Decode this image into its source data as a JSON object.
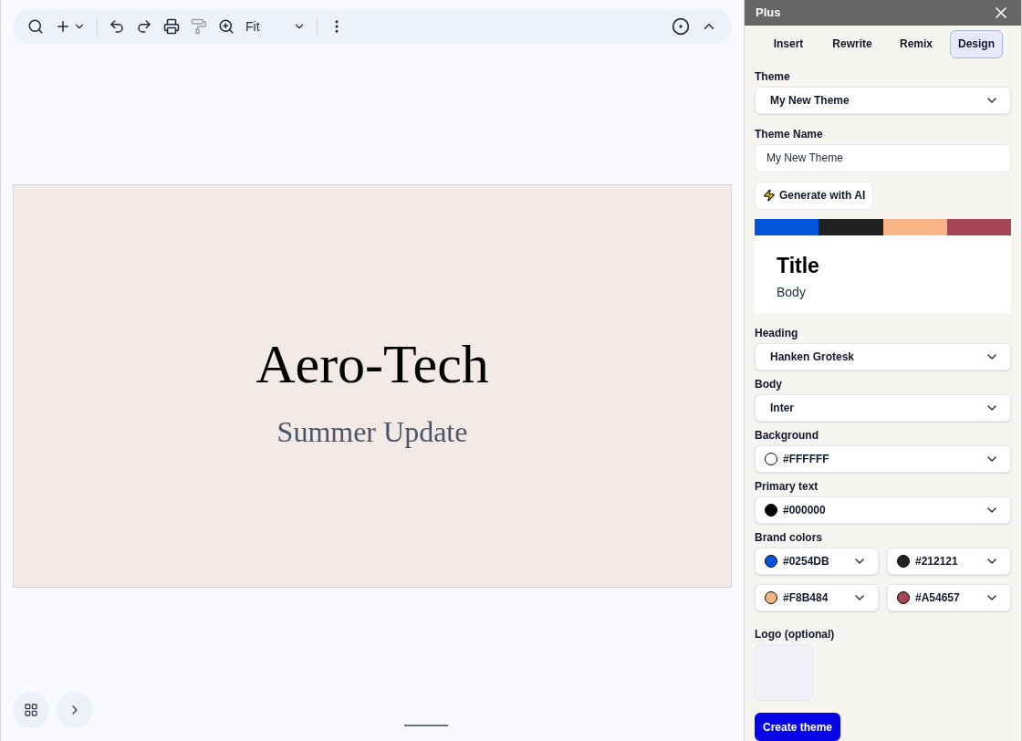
{
  "toolbar": {
    "zoom": "Fit"
  },
  "slide": {
    "title": "Aero-Tech",
    "subtitle": "Summer Update"
  },
  "panel": {
    "title": "Plus",
    "tabs": [
      {
        "label": "Insert",
        "selected": false
      },
      {
        "label": "Rewrite",
        "selected": false
      },
      {
        "label": "Remix",
        "selected": false
      },
      {
        "label": "Design",
        "selected": true
      }
    ],
    "theme": {
      "label": "Theme",
      "value": "My New Theme"
    },
    "theme_name": {
      "label": "Theme Name",
      "value": "My New Theme"
    },
    "generate_button": "Generate with AI",
    "preview": {
      "title": "Title",
      "body": "Body"
    },
    "heading": {
      "label": "Heading",
      "value": "Hanken Grotesk"
    },
    "body": {
      "label": "Body",
      "value": "Inter"
    },
    "background": {
      "label": "Background",
      "value": "#FFFFFF",
      "color": "#ffffff"
    },
    "primary_text": {
      "label": "Primary text",
      "value": "#000000",
      "color": "#000000"
    },
    "brand_colors": {
      "label": "Brand colors",
      "items": [
        {
          "value": "#0254DB",
          "color": "#0254db"
        },
        {
          "value": "#212121",
          "color": "#212121"
        },
        {
          "value": "#F8B484",
          "color": "#f8b484"
        },
        {
          "value": "#A54657",
          "color": "#a54657"
        }
      ]
    },
    "logo": {
      "label": "Logo (optional)"
    },
    "create_button": "Create theme"
  }
}
